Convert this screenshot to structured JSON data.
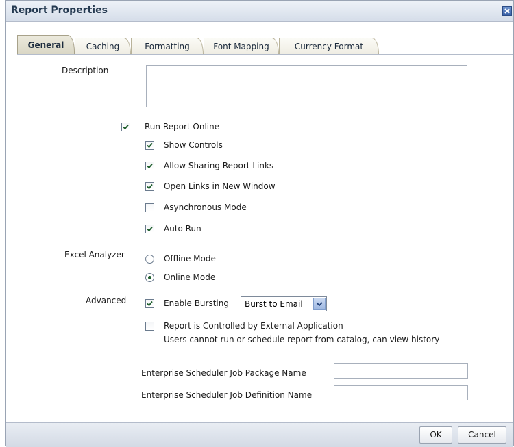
{
  "dialog": {
    "title": "Report Properties",
    "close_icon": "close-x"
  },
  "tabs": [
    {
      "label": "General",
      "active": true
    },
    {
      "label": "Caching",
      "active": false
    },
    {
      "label": "Formatting",
      "active": false
    },
    {
      "label": "Font Mapping",
      "active": false
    },
    {
      "label": "Currency Format",
      "active": false
    }
  ],
  "general": {
    "description_label": "Description",
    "description_value": "",
    "run_online": {
      "label": "Run Report Online",
      "checked": true
    },
    "options": [
      {
        "label": "Show Controls",
        "checked": true
      },
      {
        "label": "Allow Sharing Report Links",
        "checked": true
      },
      {
        "label": "Open Links in New Window",
        "checked": true
      },
      {
        "label": "Asynchronous Mode",
        "checked": false
      },
      {
        "label": "Auto Run",
        "checked": true
      }
    ],
    "excel_analyzer": {
      "label": "Excel Analyzer",
      "options": [
        {
          "label": "Offline Mode",
          "selected": false
        },
        {
          "label": "Online Mode",
          "selected": true
        }
      ]
    },
    "advanced": {
      "label": "Advanced",
      "enable_bursting": {
        "label": "Enable Bursting",
        "checked": true
      },
      "bursting_select": "Burst to Email",
      "external_app": {
        "label": "Report is Controlled by External Application",
        "checked": false,
        "note": "Users cannot run or schedule report from catalog, can view history"
      }
    },
    "scheduler": {
      "package_label": "Enterprise Scheduler Job Package Name",
      "package_value": "",
      "definition_label": "Enterprise Scheduler Job Definition Name",
      "definition_value": ""
    }
  },
  "footer": {
    "ok_label": "OK",
    "cancel_label": "Cancel"
  },
  "colors": {
    "title": "#243950",
    "check": "#1f5f2d",
    "tab_active": "#d9d6c4"
  }
}
